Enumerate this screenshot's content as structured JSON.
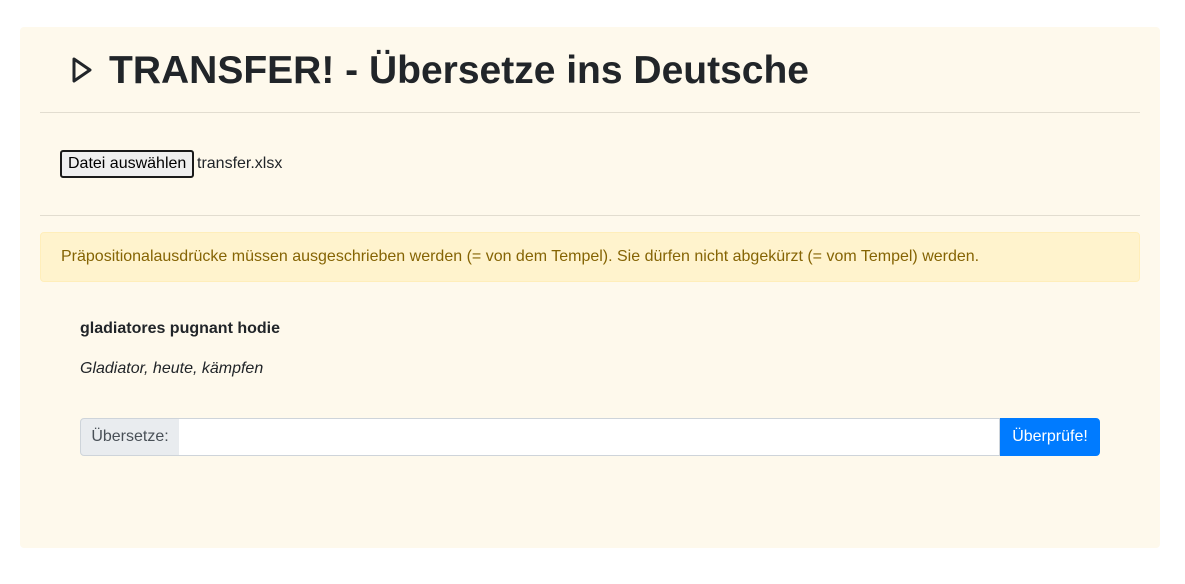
{
  "header": {
    "icon": "play-outline-icon",
    "title": "TRANSFER! - Übersetze ins Deutsche"
  },
  "file_upload": {
    "button_label": "Datei auswählen",
    "file_name": "transfer.xlsx"
  },
  "alert": {
    "text": "Präpositionalausdrücke müssen ausgeschrieben werden (= von dem Tempel). Sie dürfen nicht abgekürzt (= vom Tempel) werden."
  },
  "exercise": {
    "latin_sentence": "gladiatores pugnant hodie",
    "hint": "Gladiator, heute, kämpfen"
  },
  "translation_form": {
    "prefix_label": "Übersetze:",
    "input_value": "",
    "input_placeholder": "",
    "submit_label": "Überprüfe!"
  },
  "colors": {
    "card_background": "#fef9ec",
    "alert_background": "#fff3cd",
    "alert_text": "#856404",
    "primary": "#007bff"
  }
}
